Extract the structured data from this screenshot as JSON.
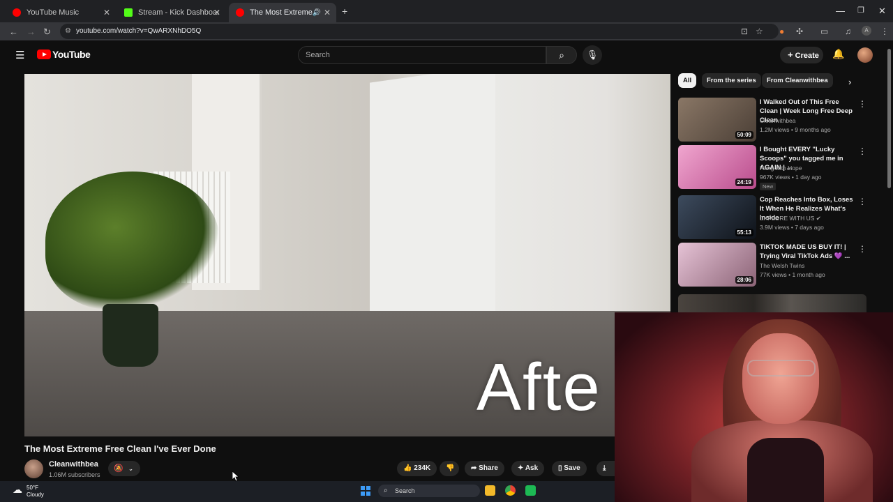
{
  "browser": {
    "tabs": [
      {
        "title": "YouTube Music",
        "favicon_color": "#ff0000"
      },
      {
        "title": "Stream - Kick Dashboard",
        "favicon_color": "#53fc18"
      },
      {
        "title": "The Most Extreme Free Cle",
        "favicon_color": "#ff0000"
      }
    ],
    "new_tab": "+",
    "url": "youtube.com/watch?v=QwARXNhDO5Q"
  },
  "youtube": {
    "logo_text": "YouTube",
    "search_placeholder": "Search",
    "create_label": "Create"
  },
  "video": {
    "overlay_text": "Afte",
    "title": "The Most Extreme Free Clean I've Ever Done",
    "channel": "Cleanwithbea",
    "subscribers": "1.06M subscribers",
    "actions": {
      "likes": "234K",
      "share": "Share",
      "ask": "Ask",
      "save": "Save"
    }
  },
  "sidebar": {
    "chips": [
      "All",
      "From the series",
      "From Cleanwithbea"
    ],
    "recommendations": [
      {
        "title": "I Walked Out of This Free Clean | Week Long Free Deep Clean",
        "channel": "Cleanwithbea",
        "meta": "1.2M views • 9 months ago",
        "duration": "50:09",
        "thumb_color": "#6a5a4e"
      },
      {
        "title": "I Bought EVERY \"Lucky Scoops\" you tagged me in AGAIN | ...",
        "channel": "Hang with Hope",
        "meta": "967K views • 1 day ago",
        "badge": "New",
        "duration": "24:19",
        "thumb_color": "#d86fa6"
      },
      {
        "title": "Cop Reaches Into Box, Loses It When He Realizes What's Inside",
        "channel": "EXPLORE WITH US",
        "meta": "3.9M views • 7 days ago",
        "duration": "55:13",
        "thumb_color": "#2f3a4a"
      },
      {
        "title": "TIKTOK MADE US BUY IT! | Trying Viral TikTok Ads 💜 ...",
        "channel": "The Welsh Twins",
        "meta": "77K views • 1 month ago",
        "duration": "28:06",
        "thumb_color": "#c9a3b8"
      }
    ]
  },
  "taskbar": {
    "temperature": "50°F",
    "weather": "Cloudy",
    "search": "Search"
  }
}
